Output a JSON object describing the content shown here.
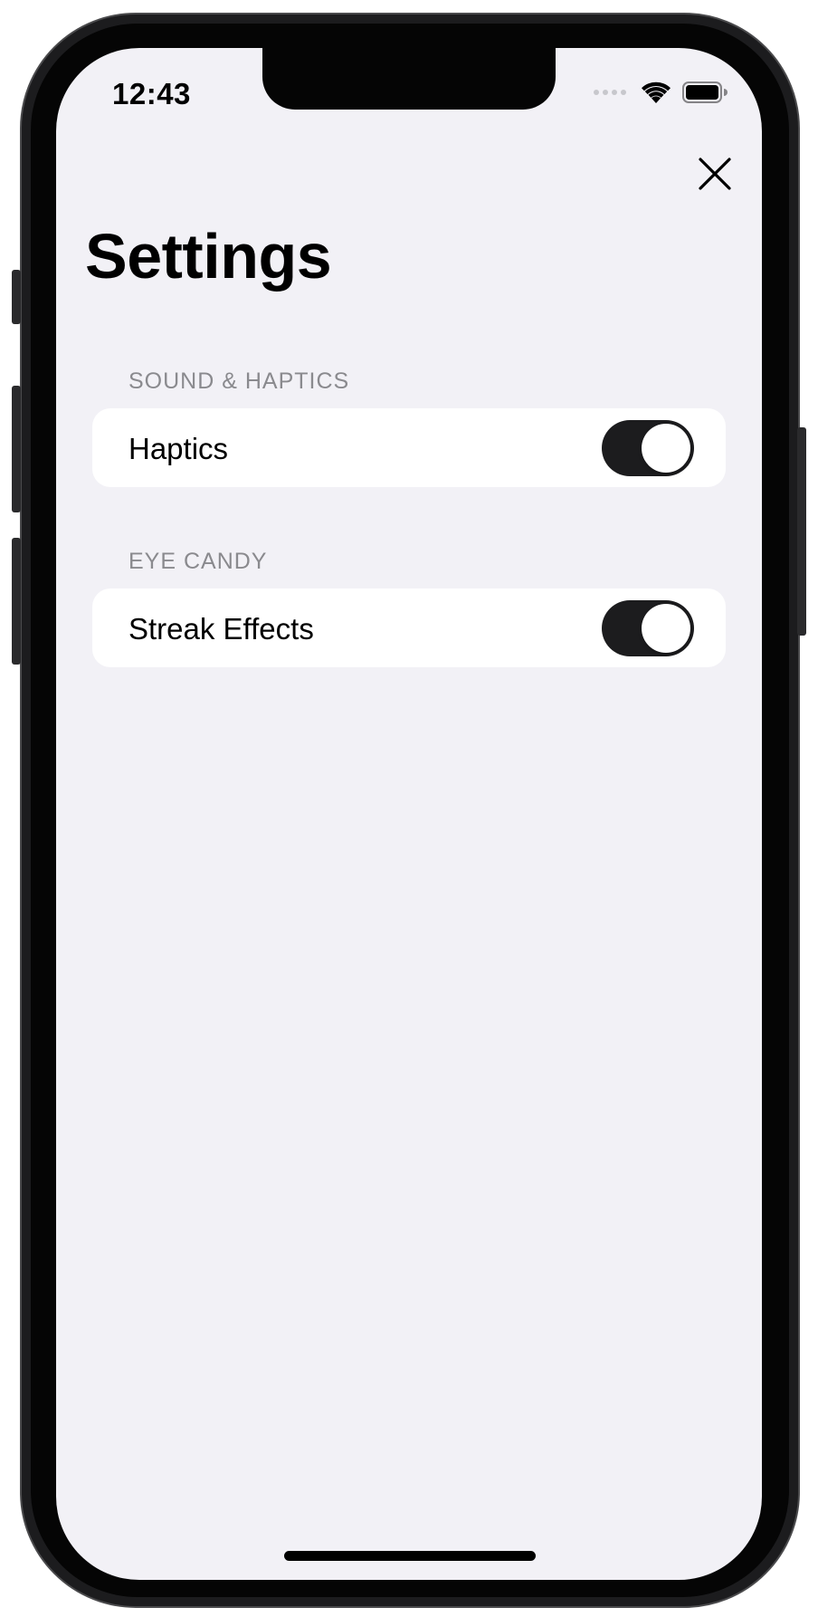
{
  "status_bar": {
    "time": "12:43",
    "icons": [
      "signal-dots-icon",
      "wifi-icon",
      "battery-icon"
    ]
  },
  "header": {
    "title": "Settings",
    "close_icon": "close-icon"
  },
  "sections": [
    {
      "header": "SOUND & HAPTICS",
      "rows": [
        {
          "label": "Haptics",
          "toggle_on": true
        }
      ]
    },
    {
      "header": "EYE CANDY",
      "rows": [
        {
          "label": "Streak Effects",
          "toggle_on": true
        }
      ]
    }
  ],
  "colors": {
    "background": "#f2f1f6",
    "cell_background": "#ffffff",
    "section_header_text": "#8a8a8e",
    "toggle_on_track": "#1c1c1e",
    "toggle_knob": "#ffffff",
    "device_frame": "#1c1c1e"
  }
}
